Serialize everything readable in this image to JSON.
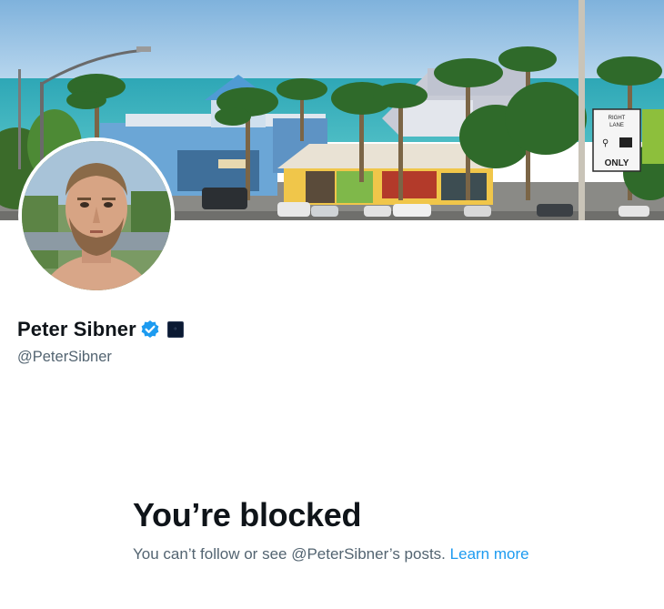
{
  "profile": {
    "display_name": "Peter Sibner",
    "handle": "@PeterSibner",
    "verified_icon": "verified-badge-icon",
    "affiliate_badge_icon": "affiliate-badge-icon",
    "verified_color": "#1d9bf0"
  },
  "banner": {
    "sign_line1": "RIGHT",
    "sign_line2": "LANE",
    "sign_line3": "ONLY"
  },
  "blocked": {
    "title": "You’re blocked",
    "message": "You can’t follow or see @PeterSibner’s posts.",
    "link_label": "Learn more"
  },
  "colors": {
    "text_primary": "#0f1419",
    "text_secondary": "#536471",
    "link": "#1d9bf0"
  }
}
